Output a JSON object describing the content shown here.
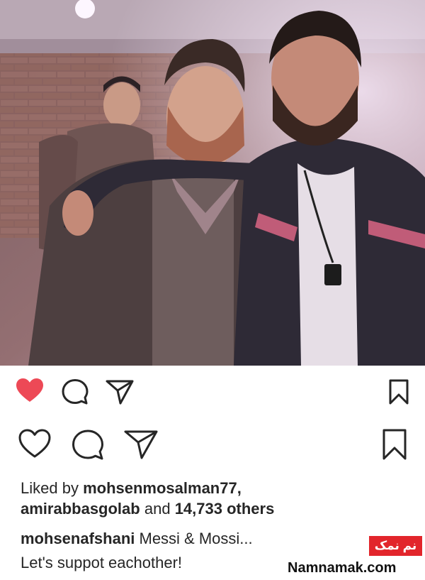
{
  "post": {
    "liked": true,
    "likes_prefix": "Liked by",
    "liked_by_user": "mohsenmosalman77",
    "liked_by_sep": ",",
    "liked_by_second": "amirabbasgolab",
    "likes_and": "and",
    "likes_count": "14,733 others",
    "caption_user": "mohsenafshani",
    "caption_text": "Messi & Mossi...",
    "caption_line2": "Let's suppot eachother!"
  },
  "watermark": {
    "badge": "نم نمک",
    "site": "Namnamak.com"
  },
  "colors": {
    "heart_active": "#ed4956",
    "icon": "#262626",
    "watermark_red": "#e2252b"
  },
  "icons": {
    "row1": [
      "heart-filled-icon",
      "comment-icon",
      "share-icon",
      "bookmark-icon"
    ],
    "row2": [
      "heart-outline-icon",
      "comment-icon",
      "share-icon",
      "bookmark-icon"
    ]
  }
}
